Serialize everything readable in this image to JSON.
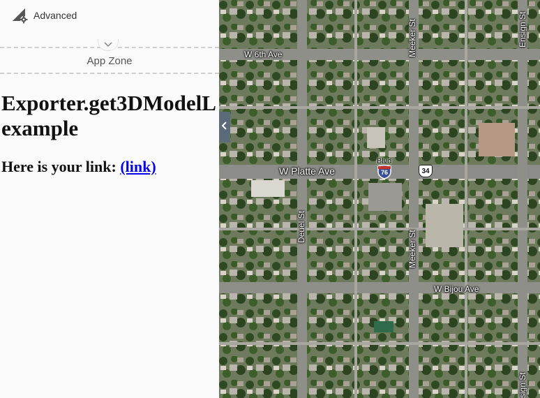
{
  "panel": {
    "advanced_label": "Advanced",
    "zone_label": "App Zone",
    "heading": "Exporter.get3DModelL",
    "heading_line2": "example",
    "link_prefix": "Here is your link:",
    "link_text": "(link)"
  },
  "map": {
    "streets": {
      "w6th": "W 6th Ave",
      "platte": "W Platte Ave",
      "bijou": "W Bijou Ave",
      "meeker_top": "Meeker St",
      "meeker_mid": "Meeker St",
      "deuel": "Deuel St",
      "ensign_top": "Ensign St",
      "ensign_bottom": "sign St",
      "blvd": "Blvd"
    },
    "shields": {
      "interstate": "76",
      "us_route": "34"
    }
  },
  "colors": {
    "link": "#0000ee",
    "panel_bg": "#fafafa",
    "collapse_tab": "#5b6b7a"
  }
}
